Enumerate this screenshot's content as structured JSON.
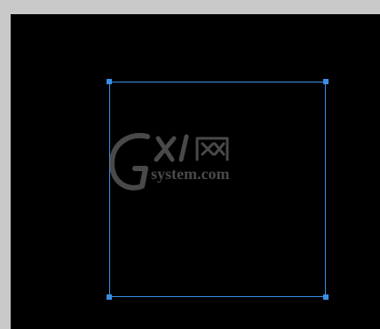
{
  "canvas": {
    "background": "#000000",
    "selection_color": "#3a8ee6"
  },
  "watermark": {
    "text": "GXI网 system.com"
  }
}
